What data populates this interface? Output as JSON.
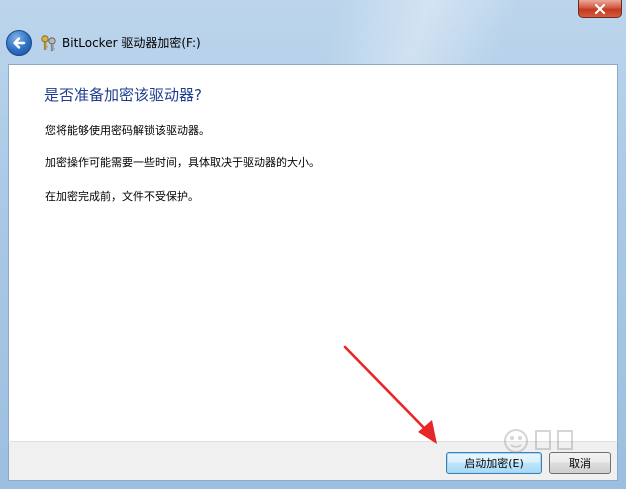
{
  "window": {
    "title": "BitLocker 驱动器加密(F:)",
    "close_glyph": "✕"
  },
  "icons": {
    "close": "close-icon",
    "back": "back-arrow-icon",
    "app": "bitlocker-keys-icon"
  },
  "main": {
    "heading": "是否准备加密该驱动器?",
    "paragraphs": [
      "您将能够使用密码解锁该驱动器。",
      "加密操作可能需要一些时间，具体取决于驱动器的大小。",
      "在加密完成前，文件不受保护。"
    ]
  },
  "footer": {
    "start_label": "启动加密(E)",
    "cancel_label": "取消"
  },
  "colors": {
    "heading": "#1e3d8f",
    "annotation_arrow": "#e8262a",
    "close_button": "#c2391f"
  }
}
